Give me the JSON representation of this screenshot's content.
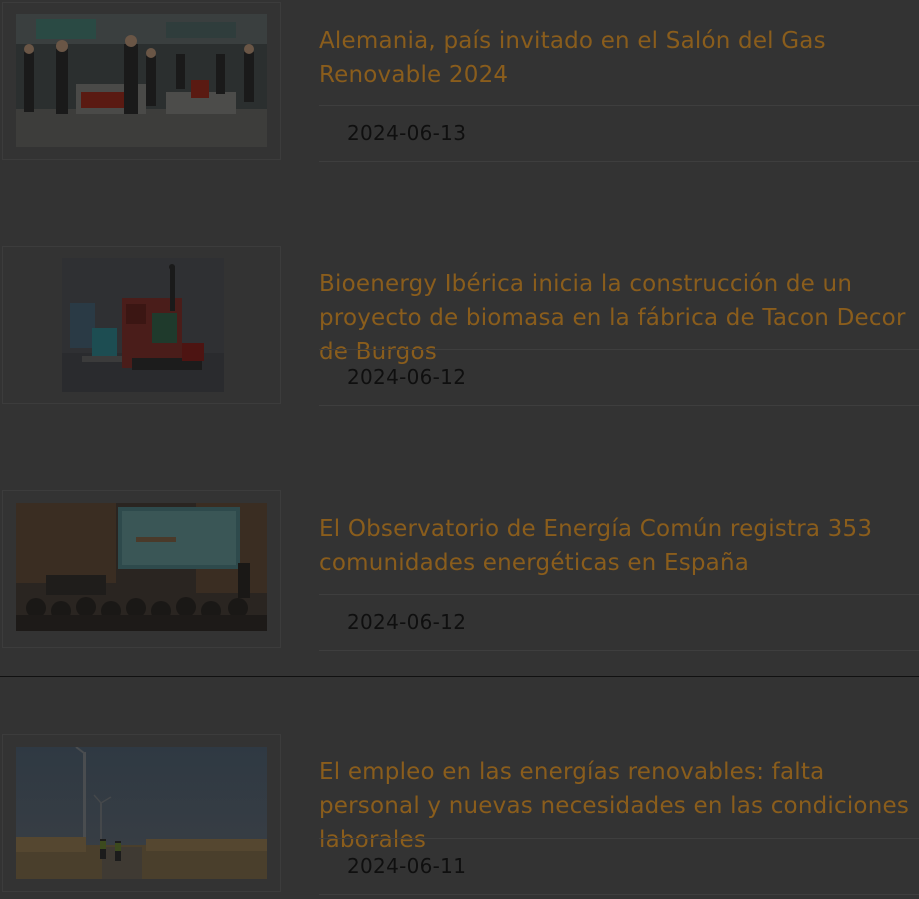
{
  "articles": [
    {
      "title": "Alemania, país invitado en el Salón del Gas Renovable 2024",
      "date": "2024-06-13",
      "image": "expo-hall-photo"
    },
    {
      "title": "Bioenergy Ibérica inicia la construcción de un proyecto de biomasa en la fábrica de Tacon Decor de Burgos",
      "date": "2024-06-12",
      "image": "biomass-plant-render"
    },
    {
      "title": "El Observatorio de Energía Común registra 353 comunidades energéticas en España",
      "date": "2024-06-12",
      "image": "conference-room-photo"
    },
    {
      "title": "El empleo en las energías renovables: falta personal y nuevas necesidades en las condiciones laborales",
      "date": "2024-06-11",
      "image": "wind-turbine-field-photo"
    }
  ],
  "colors": {
    "background": "#333333",
    "title": "#8a5d1c",
    "date": "#0f0f0f",
    "divider": "#3e3e3e"
  }
}
